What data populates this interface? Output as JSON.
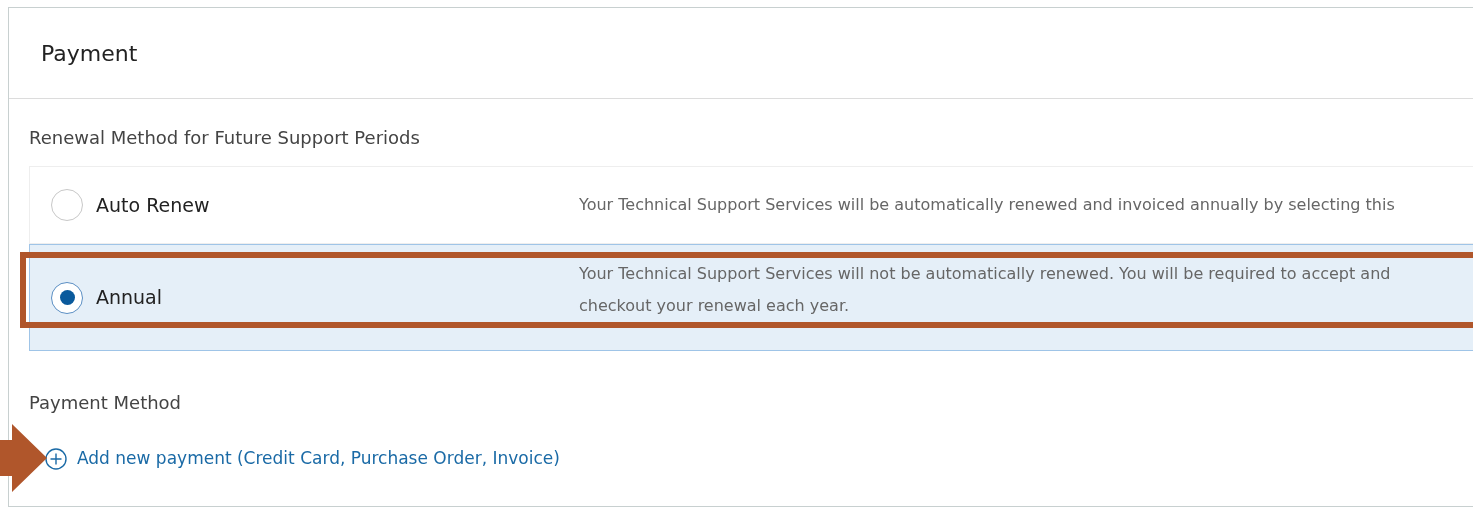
{
  "panel": {
    "title": "Payment"
  },
  "renewal": {
    "label": "Renewal Method for Future Support Periods",
    "options": [
      {
        "label": "Auto Renew",
        "selected": false,
        "description_lines": [
          "Your Technical Support Services will be automatically renewed and invoiced annually by selecting this"
        ]
      },
      {
        "label": "Annual",
        "selected": true,
        "description_lines": [
          "Your Technical Support Services will not be automatically renewed. You will be required to accept and",
          "checkout your renewal each year."
        ]
      }
    ]
  },
  "payment_method": {
    "label": "Payment Method",
    "add_link": "Add new payment (Credit Card, Purchase Order, Invoice)"
  }
}
